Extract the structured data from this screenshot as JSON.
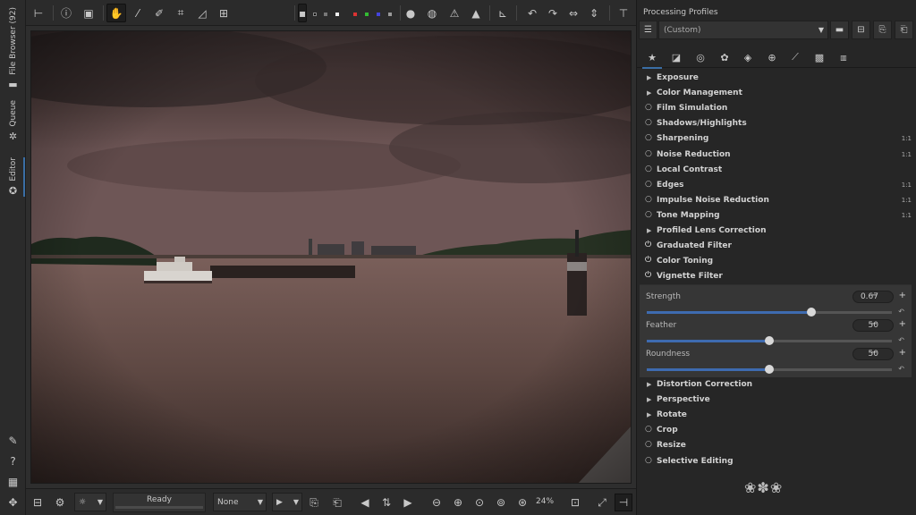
{
  "left_tabs": [
    {
      "label": "File Browser (92)",
      "icon": "folder-icon"
    },
    {
      "label": "Queue",
      "icon": "gears-icon"
    },
    {
      "label": "Editor",
      "icon": "aperture-icon"
    }
  ],
  "status": {
    "text": "Ready"
  },
  "bottom": {
    "profile_combo": "None",
    "zoom": "24%"
  },
  "panel": {
    "title": "Processing Profiles",
    "profile": "(Custom)"
  },
  "tools_top": [
    {
      "name": "Exposure",
      "kind": "expander",
      "ab": ""
    },
    {
      "name": "Color Management",
      "kind": "expander",
      "ab": ""
    },
    {
      "name": "Film Simulation",
      "kind": "power",
      "ab": ""
    },
    {
      "name": "Shadows/Highlights",
      "kind": "power",
      "ab": ""
    },
    {
      "name": "Sharpening",
      "kind": "power",
      "ab": "1:1"
    },
    {
      "name": "Noise Reduction",
      "kind": "power",
      "ab": "1:1"
    },
    {
      "name": "Local Contrast",
      "kind": "power",
      "ab": ""
    },
    {
      "name": "Edges",
      "kind": "power",
      "ab": "1:1"
    },
    {
      "name": "Impulse Noise Reduction",
      "kind": "power",
      "ab": "1:1"
    },
    {
      "name": "Tone Mapping",
      "kind": "power",
      "ab": "1:1"
    },
    {
      "name": "Profiled Lens Correction",
      "kind": "expander",
      "ab": ""
    },
    {
      "name": "Graduated Filter",
      "kind": "power-on",
      "ab": ""
    },
    {
      "name": "Color Toning",
      "kind": "power-on",
      "ab": ""
    },
    {
      "name": "Vignette Filter",
      "kind": "power-on",
      "ab": ""
    }
  ],
  "vignette": {
    "sliders": [
      {
        "label": "Strength",
        "value": "0.67",
        "fraction": 0.67
      },
      {
        "label": "Feather",
        "value": "50",
        "fraction": 0.5
      },
      {
        "label": "Roundness",
        "value": "50",
        "fraction": 0.5
      }
    ]
  },
  "tools_bottom": [
    {
      "name": "Distortion Correction",
      "kind": "expander"
    },
    {
      "name": "Perspective",
      "kind": "expander"
    },
    {
      "name": "Rotate",
      "kind": "expander"
    },
    {
      "name": "Crop",
      "kind": "power"
    },
    {
      "name": "Resize",
      "kind": "power"
    },
    {
      "name": "Selective Editing",
      "kind": "power"
    }
  ],
  "colors": {
    "accent": "#3e6bb0",
    "panel": "#262626",
    "toolbar": "#2b2b2b"
  }
}
